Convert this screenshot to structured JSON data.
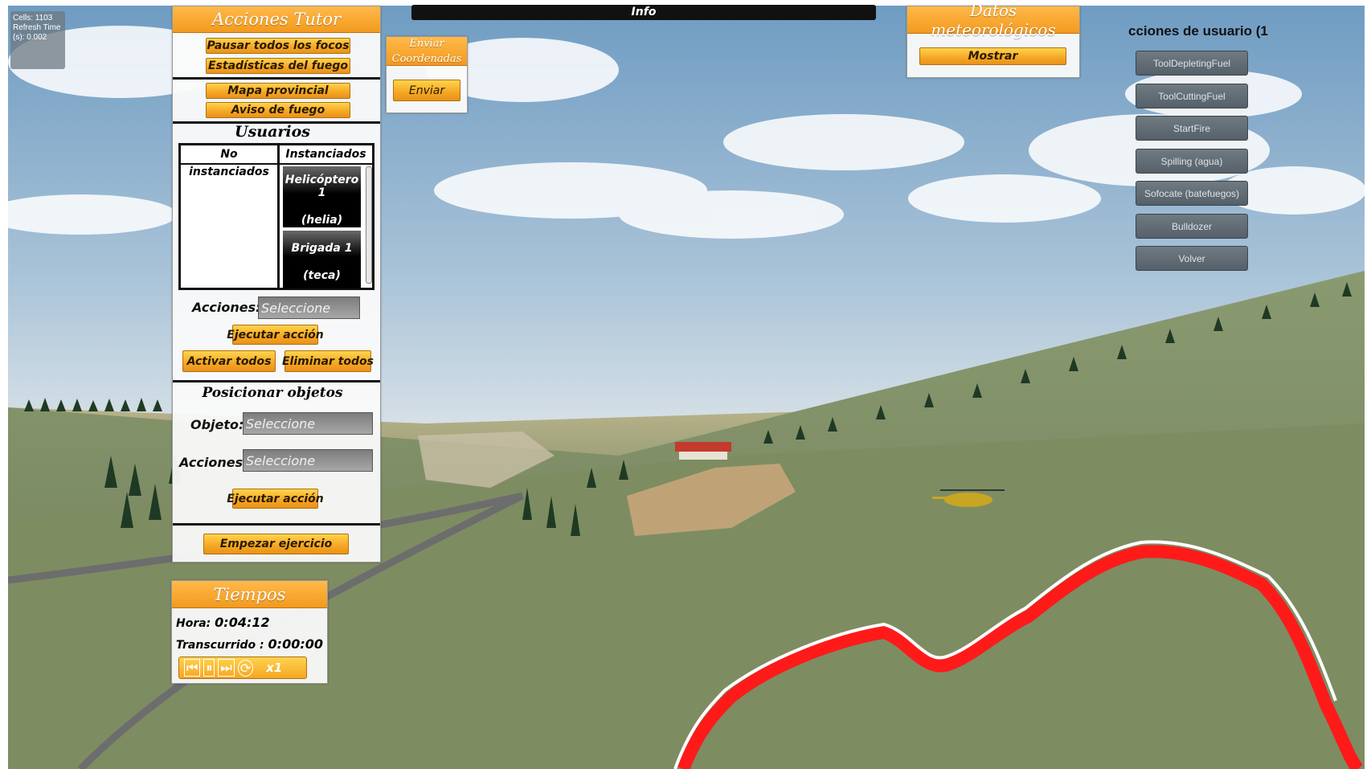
{
  "stats": {
    "cells": "Cells: 1103",
    "refresh": "Refresh Time (s): 0.002"
  },
  "tutor": {
    "title": "Acciones Tutor",
    "buttons": [
      "Pausar todos los focos",
      "Estadísticas del fuego",
      "Mapa provincial",
      "Aviso de fuego"
    ],
    "users": {
      "title": "Usuarios",
      "col_not_instanced": "No instanciados",
      "col_instanced": "Instanciados",
      "instanced": [
        {
          "name": "Helicóptero 1",
          "sub": "(helia)"
        },
        {
          "name": "Brigada 1",
          "sub": "(teca)"
        }
      ]
    },
    "actions_label": "Acciones:",
    "actions_value": "Seleccione",
    "execute": "Ejecutar acción",
    "activate_all": "Activar todos",
    "delete_all": "Eliminar todos",
    "position": {
      "title": "Posicionar objetos",
      "object_label": "Objeto:",
      "object_value": "Seleccione",
      "actions_label": "Acciones:",
      "actions_value": "Seleccione",
      "execute": "Ejecutar acción"
    },
    "start": "Empezar ejercicio"
  },
  "coords": {
    "title": "Enviar Coordenadas",
    "send": "Enviar"
  },
  "info": {
    "title": "Info"
  },
  "weather": {
    "title": "Datos meteorológicos",
    "show": "Mostrar"
  },
  "user_actions": {
    "title": "cciones de usuario (1",
    "buttons": [
      "ToolDepletingFuel",
      "ToolCuttingFuel",
      "StartFire",
      "Spilling (agua)",
      "Sofocate (batefuegos)",
      "Bulldozer",
      "Volver"
    ]
  },
  "times": {
    "title": "Tiempos",
    "hora_label": "Hora:",
    "hora": "0:04:12",
    "transcurrido_label": "Transcurrido :",
    "transcurrido": "0:00:00",
    "speed": "x1"
  },
  "colors": {
    "accent": "#f5a623",
    "fire": "#ff1a1a",
    "grass": "#7a8a5e",
    "sky": "#8fb3cf"
  }
}
